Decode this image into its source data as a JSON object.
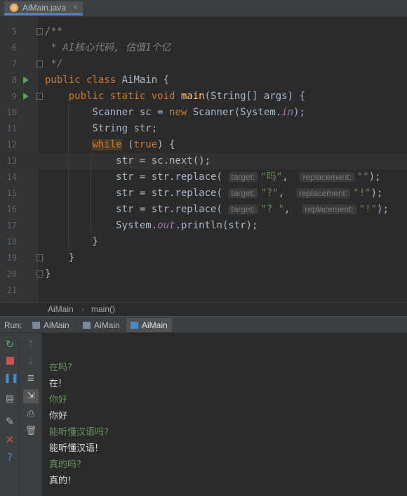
{
  "editor_tab": {
    "filename": "AiMain.java",
    "close": "×"
  },
  "editor": {
    "lines": [
      {
        "num": "5",
        "html": "<span class=\"com\">/**</span>"
      },
      {
        "num": "6",
        "html": "<span class=\"com\"> * AI核心代码, 估值1个亿</span>"
      },
      {
        "num": "7",
        "html": "<span class=\"com\"> */</span>"
      },
      {
        "num": "8",
        "html": "<span class=\"kw\">public class</span> AiMain {"
      },
      {
        "num": "9",
        "html": "    <span class=\"kw\">public static void</span> <span class=\"fn\">main</span>(String[] args) {"
      },
      {
        "num": "10",
        "html": "        Scanner sc = <span class=\"kw\">new</span> Scanner(System.<span class=\"fld\">in</span>);"
      },
      {
        "num": "11",
        "html": "        String str;"
      },
      {
        "num": "12",
        "html": "        <span class=\"kw while-hl\">while</span> (<span class=\"kw\">true</span>) {"
      },
      {
        "num": "13",
        "html": "            str = sc.next();"
      },
      {
        "num": "14",
        "html": "            str = str.replace( <span class=\"hint\">target:</span><span class=\"str\">\"吗\"</span>,  <span class=\"hint\">replacement:</span><span class=\"str\">\"\"</span>);"
      },
      {
        "num": "15",
        "html": "            str = str.replace( <span class=\"hint\">target:</span><span class=\"str\">\"?\"</span>,  <span class=\"hint\">replacement:</span><span class=\"str\">\"!\"</span>);"
      },
      {
        "num": "16",
        "html": "            str = str.replace( <span class=\"hint\">target:</span><span class=\"str\">\"? \"</span>,  <span class=\"hint\">replacement:</span><span class=\"str\">\"!\"</span>);"
      },
      {
        "num": "17",
        "html": "            System.<span class=\"fld\">out</span>.println(str);"
      },
      {
        "num": "18",
        "html": "        }"
      },
      {
        "num": "19",
        "html": "    }"
      },
      {
        "num": "20",
        "html": "}"
      },
      {
        "num": "21",
        "html": ""
      }
    ]
  },
  "breadcrumb": {
    "class_name": "AiMain",
    "separator": "›",
    "method_name": "main()"
  },
  "run_panel": {
    "label": "Run:",
    "tabs": [
      "AiMain",
      "AiMain",
      "AiMain"
    ],
    "active_tab_index": 2,
    "console": [
      {
        "kind": "in",
        "text": "在吗?"
      },
      {
        "kind": "out",
        "text": "在!"
      },
      {
        "kind": "in",
        "text": "你好"
      },
      {
        "kind": "out",
        "text": "你好"
      },
      {
        "kind": "in",
        "text": "能听懂汉语吗?"
      },
      {
        "kind": "out",
        "text": "能听懂汉语!"
      },
      {
        "kind": "in",
        "text": "真的吗?"
      },
      {
        "kind": "out",
        "text": "真的!"
      }
    ],
    "toolbar_icons": [
      "rerun-icon",
      "stop-icon",
      "pause-icon",
      "dump-threads-icon",
      "pin-icon",
      "close-icon",
      "help-icon"
    ],
    "toolbar2_icons": [
      "up-arrow-icon",
      "down-arrow-icon",
      "soft-wrap-icon",
      "scroll-to-end-icon",
      "print-icon",
      "trash-icon"
    ]
  },
  "colors": {
    "background": "#2b2b2b",
    "keyword": "#cc7832",
    "method": "#ffc66d",
    "string": "#6a8759",
    "comment": "#808080",
    "field": "#9876aa",
    "console_input": "#629755",
    "accent": "#4a88c7"
  }
}
